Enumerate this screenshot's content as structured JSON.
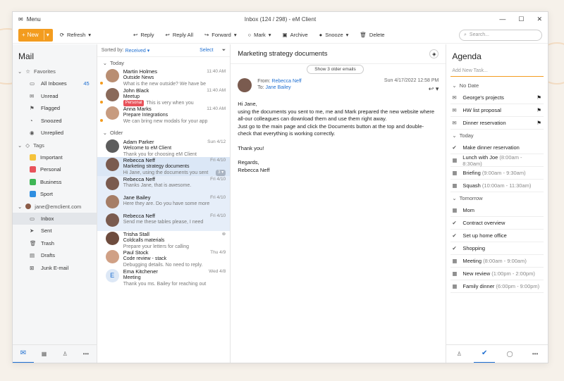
{
  "window": {
    "title": "Inbox (124 / 298) - eM Client",
    "menu": "Menu"
  },
  "toolbar": {
    "new": "New",
    "refresh": "Refresh",
    "reply": "Reply",
    "reply_all": "Reply All",
    "forward": "Forward",
    "mark": "Mark",
    "archive": "Archive",
    "snooze": "Snooze",
    "delete": "Delete",
    "search_placeholder": "Search..."
  },
  "sidebar": {
    "title": "Mail",
    "favorites_label": "Favorites",
    "favorites": [
      {
        "label": "All Inboxes",
        "count": "45",
        "icon": "inbox-icon"
      },
      {
        "label": "Unread",
        "icon": "envelope-icon"
      },
      {
        "label": "Flagged",
        "icon": "flag-icon"
      },
      {
        "label": "Snoozed",
        "icon": "bell-icon"
      },
      {
        "label": "Unreplied",
        "icon": "eye-icon"
      }
    ],
    "tags_label": "Tags",
    "tags": [
      {
        "label": "Important",
        "color": "#f5c33b"
      },
      {
        "label": "Personal",
        "color": "#e8535b"
      },
      {
        "label": "Business",
        "color": "#3fb655"
      },
      {
        "label": "Sport",
        "color": "#2f8ee0"
      }
    ],
    "account": "jane@emclient.com",
    "folders": [
      {
        "label": "Inbox",
        "icon": "inbox-icon"
      },
      {
        "label": "Sent",
        "icon": "send-icon"
      },
      {
        "label": "Trash",
        "icon": "trash-icon"
      },
      {
        "label": "Drafts",
        "icon": "draft-icon"
      },
      {
        "label": "Junk E-mail",
        "icon": "junk-icon"
      }
    ]
  },
  "list": {
    "sorted_by_label": "Sorted by:",
    "sorted_by": "Received",
    "select": "Select",
    "today_label": "Today",
    "older_label": "Older",
    "today": [
      {
        "name": "Martin Holmes",
        "date": "11:40 AM",
        "subject": "Outside News",
        "preview": "What is the new outside? We have be",
        "unread": true,
        "color": "#b98e72"
      },
      {
        "name": "John Black",
        "date": "11:40 AM",
        "subject": "Meetup",
        "tag": "Personal",
        "preview": "This is very when you",
        "unread": true,
        "color": "#8a6a5a"
      },
      {
        "name": "Anna Marks",
        "date": "11:40 AM",
        "subject": "Prepare Integrations",
        "preview": "We can bring new modals for your app",
        "unread": true,
        "color": "#c79b7f"
      }
    ],
    "older": [
      {
        "name": "Adam Parker",
        "date": "Sun 4/12",
        "subject": "Welcome to eM Client",
        "preview": "Thank you for choosing eM Client",
        "color": "#5d5d5d"
      },
      {
        "name": "Rebecca Neff",
        "date": "Fri 4/10",
        "subject": "Marketing strategy documents",
        "preview": "Hi Jane, using the documents you sent",
        "badge": "3",
        "color": "#7a5b4f",
        "selected": true
      },
      {
        "name": "Rebecca Neff",
        "date": "Fri 4/10",
        "subject": "",
        "preview": "Thanks Jane, that is awesome.",
        "color": "#7a5b4f",
        "thread": true
      },
      {
        "name": "Jane Bailey",
        "date": "Fri 4/10",
        "subject": "",
        "preview": "Here they are. Do you have some more",
        "color": "#a57d66",
        "thread": true
      },
      {
        "name": "Rebecca Neff",
        "date": "Fri 4/10",
        "subject": "",
        "preview": "Send me these tables please, I need",
        "color": "#7a5b4f",
        "thread": true
      },
      {
        "name": "Trisha Stall",
        "date": "",
        "subject": "Coldcalls materials",
        "preview": "Prepare your letters for calling",
        "color": "#6e4c3e"
      },
      {
        "name": "Paul Stock",
        "date": "Thu 4/9",
        "subject": "Code review - stack",
        "preview": "Debugging details. No need to reply.",
        "color": "#d0a085"
      },
      {
        "name": "Ema Kitchener",
        "date": "Wed 4/8",
        "subject": "Meeting",
        "preview": "Thank you ms. Bailey for reaching out",
        "initial": "E",
        "color": "#dde8f6"
      }
    ]
  },
  "reader": {
    "subject": "Marketing strategy documents",
    "show_older": "Show 3 older emails",
    "from_label": "From:",
    "from": "Rebecca Neff",
    "to_label": "To:",
    "to": "Jane Bailey",
    "date": "Sun 4/17/2022 12:58 PM",
    "body": [
      "Hi Jane,",
      "using the documents you sent to me, me and Mark prepared the new website where all-our colleagues can download them and use them right away.",
      "Just go to the main page and click the Documents button at the top and double-check that everything is working correctly.",
      "Thank you!",
      "Regards,",
      "Rebecca Neff"
    ]
  },
  "agenda": {
    "title": "Agenda",
    "new_task_placeholder": "Add New Task...",
    "groups": [
      {
        "label": "No Date",
        "items": [
          {
            "label": "George's projects",
            "icon": "task-icon",
            "flag": true
          },
          {
            "label": "HW list proposal",
            "icon": "task-icon",
            "flag": true
          },
          {
            "label": "Dinner reservation",
            "icon": "task-icon",
            "flag": true
          }
        ]
      },
      {
        "label": "Today",
        "items": [
          {
            "label": "Make dinner reservation",
            "icon": "check-icon"
          },
          {
            "label": "Lunch with Joe",
            "time": "(8:00am - 8:30am)",
            "icon": "calendar-icon"
          },
          {
            "label": "Briefing",
            "time": "(9:00am - 9:30am)",
            "icon": "calendar-icon"
          },
          {
            "label": "Squash",
            "time": "(10:00am - 11:30am)",
            "icon": "calendar-icon"
          }
        ]
      },
      {
        "label": "Tomorrow",
        "items": [
          {
            "label": "Mom",
            "icon": "calendar-icon"
          },
          {
            "label": "Contract overview",
            "icon": "check-icon"
          },
          {
            "label": "Set up home office",
            "icon": "check-icon"
          },
          {
            "label": "Shopping",
            "icon": "check-icon"
          },
          {
            "label": "Meeting",
            "time": "(8:00am - 9:00am)",
            "icon": "calendar-icon"
          },
          {
            "label": "New review",
            "time": "(1:00pm - 2:00pm)",
            "icon": "calendar-icon"
          },
          {
            "label": "Family dinner",
            "time": "(6:00pm - 9:00pm)",
            "icon": "calendar-icon"
          }
        ]
      }
    ]
  },
  "colors": {
    "accent": "#f39c1f",
    "link": "#1f6fd1",
    "selection": "#dbe7f6"
  }
}
